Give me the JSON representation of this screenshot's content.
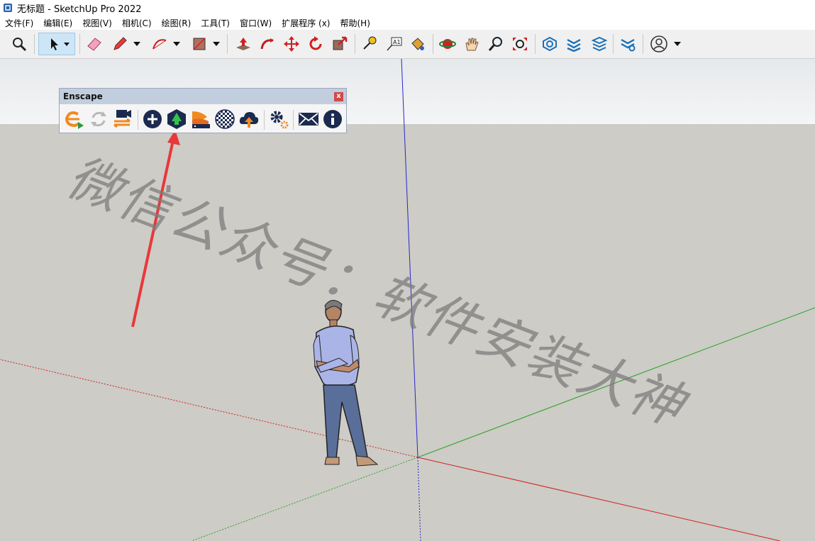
{
  "window": {
    "title": "无标题 - SketchUp Pro 2022"
  },
  "menubar": {
    "items": [
      "文件(F)",
      "编辑(E)",
      "视图(V)",
      "相机(C)",
      "绘图(R)",
      "工具(T)",
      "窗口(W)",
      "扩展程序 (x)",
      "帮助(H)"
    ]
  },
  "toolbar": {
    "icons": [
      "search-icon",
      "select-arrow-icon",
      "eraser-icon",
      "pencil-icon",
      "arc-icon",
      "rectangle-icon",
      "push-pull-icon",
      "follow-me-icon",
      "move-icon",
      "rotate-icon",
      "scale-icon",
      "tape-measure-icon",
      "text-icon",
      "paint-bucket-icon",
      "orbit-icon",
      "pan-icon",
      "zoom-icon",
      "zoom-extents-icon",
      "sandbox-icon",
      "layers-icon",
      "stack-icon",
      "extension-icon",
      "account-icon"
    ]
  },
  "enscape": {
    "title": "Enscape",
    "close": "x",
    "buttons": [
      "enscape-start-icon",
      "live-updates-icon",
      "video-editor-icon",
      "add-asset-icon",
      "asset-library-icon",
      "material-editor-icon",
      "panorama-icon",
      "cloud-upload-icon",
      "settings-icon",
      "feedback-mail-icon",
      "about-icon"
    ]
  },
  "annotation": {
    "arrow_color": "#e8383b"
  },
  "watermark": {
    "text": "微信公众号：软件安装大神"
  },
  "colors": {
    "axis_red": "#d02020",
    "axis_green": "#28a028",
    "axis_blue": "#2828c8"
  }
}
